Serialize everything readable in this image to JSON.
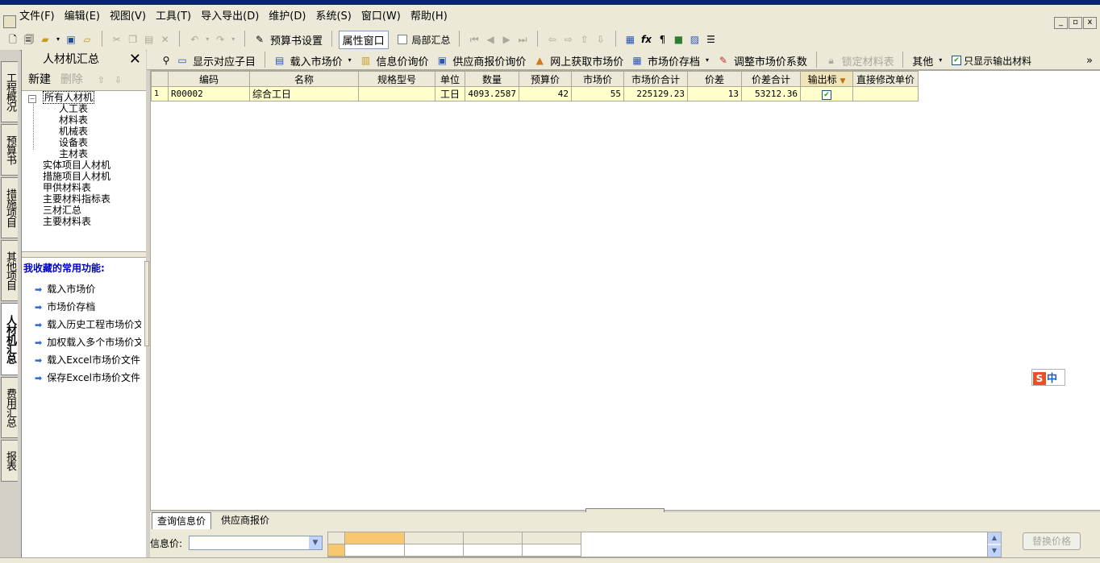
{
  "menu": [
    "文件(F)",
    "编辑(E)",
    "视图(V)",
    "工具(T)",
    "导入导出(D)",
    "维护(D)",
    "系统(S)",
    "窗口(W)",
    "帮助(H)"
  ],
  "window_controls": [
    "_",
    "▫",
    "x"
  ],
  "toolbar1": {
    "budget_settings": "预算书设置",
    "property_window": "属性窗口",
    "partial_summary": "局部汇总"
  },
  "vtabs": [
    "工程概况",
    "预算书",
    "措施项目",
    "其他项目",
    "人材机汇总",
    "费用汇总",
    "报表"
  ],
  "left_panel": {
    "title": "人材机汇总",
    "close": "✕",
    "new": "新建",
    "delete": "删除",
    "tree": {
      "root": "所有人材机",
      "children": [
        "人工表",
        "材料表",
        "机械表",
        "设备表",
        "主材表"
      ],
      "others": [
        "实体项目人材机",
        "措施项目人材机",
        "甲供材料表",
        "主要材料指标表",
        "三材汇总",
        "主要材料表"
      ]
    },
    "favorites_title": "我收藏的常用功能:",
    "favorites": [
      "载入市场价",
      "市场价存档",
      "载入历史工程市场价文件",
      "加权载入多个市场价文件",
      "载入Excel市场价文件",
      "保存Excel市场价文件"
    ]
  },
  "main_toolbar": {
    "show_subitem": "显示对应子目",
    "load_market": "载入市场价",
    "info_price": "信息价询价",
    "supplier_price": "供应商报价询价",
    "online_price": "网上获取市场价",
    "market_archive": "市场价存档",
    "adjust_coef": "调整市场价系数",
    "lock_table": "锁定材料表",
    "others": "其他",
    "only_output": "只显示输出材料",
    "more": "»"
  },
  "grid": {
    "columns": [
      "",
      "编码",
      "名称",
      "规格型号",
      "单位",
      "数量",
      "预算价",
      "市场价",
      "市场价合计",
      "价差",
      "价差合计",
      "输出标",
      "直接修改单价"
    ],
    "rows": [
      {
        "no": "1",
        "code": "R00002",
        "name": "综合工日",
        "spec": "",
        "unit": "工日",
        "qty": "4093.2587",
        "budget": "42",
        "market": "55",
        "market_total": "225129.23",
        "diff": "13",
        "diff_total": "53212.36",
        "output": true,
        "direct": ""
      }
    ]
  },
  "ime": {
    "logo": "S",
    "mode": "中"
  },
  "bottom_tabs": [
    "查询信息价",
    "供应商报价"
  ],
  "info": {
    "label": "信息价:",
    "replace_button": "替换价格"
  }
}
